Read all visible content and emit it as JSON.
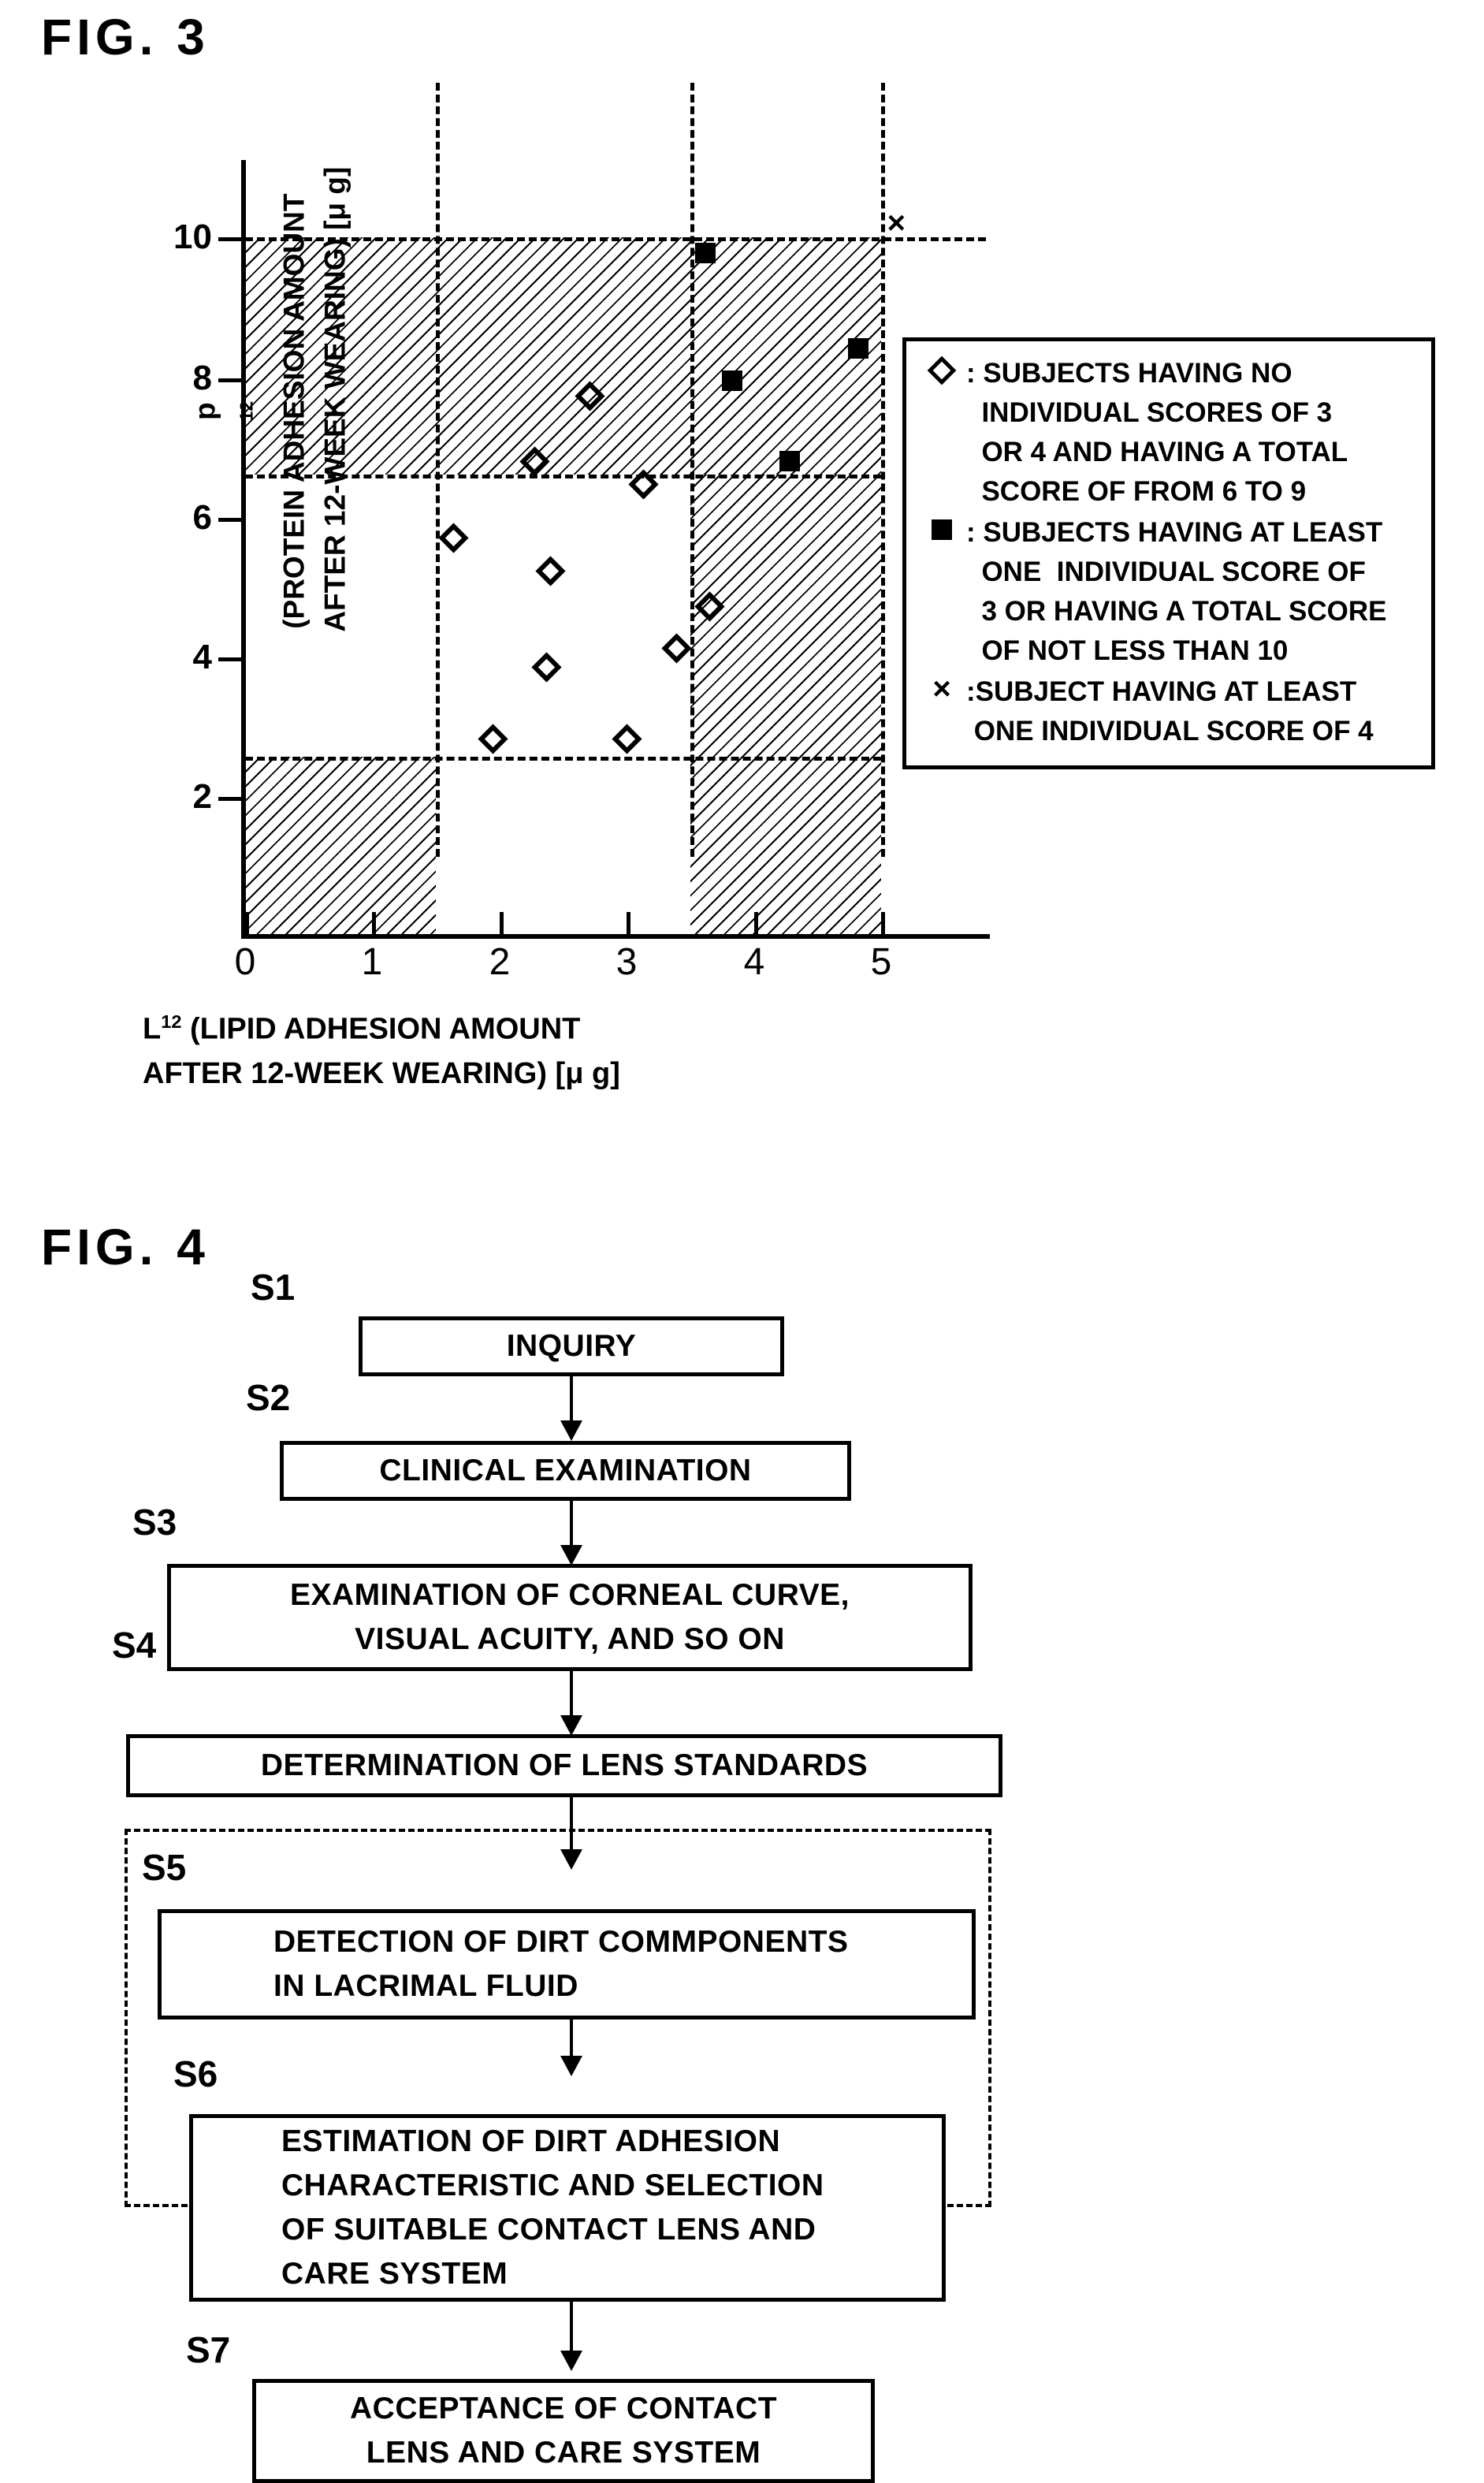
{
  "fig3": {
    "label": "FIG. 3",
    "axes": {
      "x_title_line1": "L12 (LIPID ADHESION AMOUNT",
      "x_title_line2": "AFTER 12-WEEK WEARING) [μ g]",
      "x_base": "L",
      "x_sup": "12",
      "x_rest": " (LIPID ADHESION AMOUNT",
      "y_base": "p",
      "y_sup": "12",
      "y_line1_rest": " (PROTEIN ADHESION AMOUNT",
      "y_line2": "AFTER 12-WEEK WEARING)  [μ g]",
      "x_ticks": [
        "0",
        "1",
        "2",
        "3",
        "4",
        "5"
      ],
      "y_ticks": [
        "2",
        "4",
        "6",
        "8",
        "10"
      ]
    },
    "legend": {
      "entries": [
        {
          "symbol": "diamond",
          "lines": [
            ": SUBJECTS HAVING NO",
            "  INDIVIDUAL SCORES OF 3",
            "  OR 4 AND HAVING A TOTAL",
            "  SCORE OF FROM 6 TO 9"
          ]
        },
        {
          "symbol": "square",
          "lines": [
            ": SUBJECTS HAVING AT LEAST",
            "  ONE  INDIVIDUAL SCORE OF",
            "  3 OR HAVING A TOTAL SCORE",
            "  OF NOT LESS THAN 10"
          ]
        },
        {
          "symbol": "cross",
          "lines": [
            ":SUBJECT HAVING AT LEAST",
            " ONE INDIVIDUAL SCORE OF 4"
          ]
        }
      ]
    }
  },
  "chart_data": {
    "type": "scatter",
    "title": "FIG. 3",
    "xlabel": "L12 (LIPID ADHESION AMOUNT AFTER 12-WEEK WEARING) [μ g]",
    "ylabel": "p12 (PROTEIN ADHESION AMOUNT AFTER 12-WEEK WEARING) [μ g]",
    "xlim": [
      0,
      5.85
    ],
    "ylim": [
      0,
      11.1
    ],
    "xticks": [
      0,
      1,
      2,
      3,
      4,
      5
    ],
    "yticks": [
      2,
      4,
      6,
      8,
      10
    ],
    "grid": false,
    "legend_position": "right",
    "series": [
      {
        "name": "SUBJECTS HAVING NO INDIVIDUAL SCORES OF 3 OR 4 AND HAVING A TOTAL SCORE OF FROM 6 TO 9",
        "marker": "diamond",
        "points": [
          [
            1.64,
            5.68
          ],
          [
            1.95,
            2.8
          ],
          [
            2.37,
            3.83
          ],
          [
            2.4,
            5.2
          ],
          [
            2.71,
            7.72
          ],
          [
            3.0,
            2.8
          ],
          [
            3.13,
            6.45
          ],
          [
            3.39,
            4.1
          ],
          [
            3.65,
            4.7
          ],
          [
            2.28,
            6.78
          ]
        ]
      },
      {
        "name": "SUBJECTS HAVING AT LEAST ONE INDIVIDUAL SCORE OF 3 OR HAVING A TOTAL SCORE OF NOT LESS THAN 10",
        "marker": "square",
        "points": [
          [
            3.62,
            9.77
          ],
          [
            3.83,
            7.93
          ],
          [
            4.28,
            6.78
          ],
          [
            4.82,
            8.4
          ]
        ]
      },
      {
        "name": "SUBJECT HAVING AT LEAST ONE INDIVIDUAL SCORE OF 4",
        "marker": "cross",
        "points": [
          [
            5.12,
            10.2
          ]
        ]
      }
    ],
    "reference_lines": {
      "vertical": [
        1.5,
        3.5,
        5.0
      ],
      "horizontal": [
        2.55,
        6.6,
        10.0
      ]
    },
    "hatched_regions": [
      {
        "x0": 0.0,
        "x1": 5.0,
        "y0": 6.6,
        "y1": 10.0
      },
      {
        "x0": 0.0,
        "x1": 1.5,
        "y0": 0.0,
        "y1": 2.55
      },
      {
        "x0": 3.5,
        "x1": 5.0,
        "y0": 0.0,
        "y1": 6.6
      }
    ]
  },
  "fig4": {
    "label": "FIG. 4",
    "steps": [
      {
        "id": "S1",
        "text": "INQUIRY"
      },
      {
        "id": "S2",
        "text": "CLINICAL EXAMINATION"
      },
      {
        "id": "S3",
        "line1": "EXAMINATION OF CORNEAL CURVE,",
        "line2": "VISUAL ACUITY, AND SO ON"
      },
      {
        "id": "S4",
        "text": "DETERMINATION OF LENS STANDARDS"
      },
      {
        "id": "S5",
        "line1": "DETECTION OF DIRT COMMPONENTS",
        "line2": "IN LACRIMAL FLUID"
      },
      {
        "id": "S6",
        "line1": "ESTIMATION OF DIRT ADHESION",
        "line2": "CHARACTERISTIC AND SELECTION",
        "line3": "OF SUITABLE CONTACT LENS AND",
        "line4": "CARE SYSTEM"
      },
      {
        "id": "S7",
        "line1": "ACCEPTANCE OF CONTACT",
        "line2": "LENS AND CARE SYSTEM"
      }
    ]
  }
}
